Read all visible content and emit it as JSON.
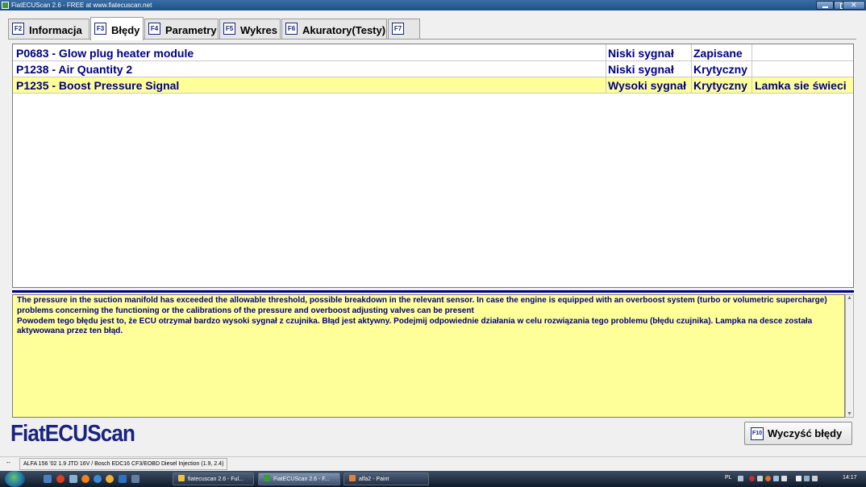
{
  "window": {
    "title": "FiatECUScan 2.6 - FREE at www.fiatecuscan.net"
  },
  "tabs": [
    {
      "key": "F2",
      "label": "Informacja"
    },
    {
      "key": "F3",
      "label": "Błędy",
      "active": true
    },
    {
      "key": "F4",
      "label": "Parametry"
    },
    {
      "key": "F5",
      "label": "Wykres"
    },
    {
      "key": "F6",
      "label": "Akuratory(Testy)"
    },
    {
      "key": "F7",
      "label": ""
    }
  ],
  "faults": [
    {
      "code": "P0683 - Glow plug heater module",
      "signal": "Niski sygnał",
      "status": "Zapisane",
      "lamp": ""
    },
    {
      "code": "P1238 - Air Quantity 2",
      "signal": "Niski sygnał",
      "status": "Krytyczny",
      "lamp": ""
    },
    {
      "code": "P1235 - Boost Pressure Signal",
      "signal": "Wysoki sygnał",
      "status": "Krytyczny",
      "lamp": "Lamka sie świeci",
      "selected": true
    }
  ],
  "description": {
    "line1": "The pressure in the suction manifold has exceeded the allowable threshold, possible breakdown in the relevant sensor. In case the engine is equipped with an overboost system (turbo or volumetric supercharge) problems concerning the functioning or the calibrations of the pressure and overboost adjusting valves can be present",
    "line2": "Powodem tego błędu jest to, że ECU otrzymał bardzo wysoki sygnał z czujnika. Błąd jest aktywny. Podejmij odpowiednie działania w celu rozwiązania tego problemu (błędu czujnika). Lampka na desce została aktywowana przez ten błąd."
  },
  "logo": "FiatECUScan",
  "clear_button": {
    "key": "F10",
    "label": "Wyczyść błędy"
  },
  "statusbar": {
    "left": "--",
    "vehicle": "ALFA 156 '02 1.9 JTD 16V / Bosch EDC16 CF3/EOBD Diesel Injection (1.9, 2.4)"
  },
  "taskbar": {
    "tasks": [
      {
        "label": "fiatecuscan 2.6 - Ful...",
        "icon_color": "#f0c040"
      },
      {
        "label": "FiatECUScan 2.6 - F...",
        "icon_color": "#3a9a3a",
        "active": true
      },
      {
        "label": "alfa2 - Paint",
        "icon_color": "#e08040"
      }
    ],
    "lang": "PL",
    "clock": "14:17"
  }
}
